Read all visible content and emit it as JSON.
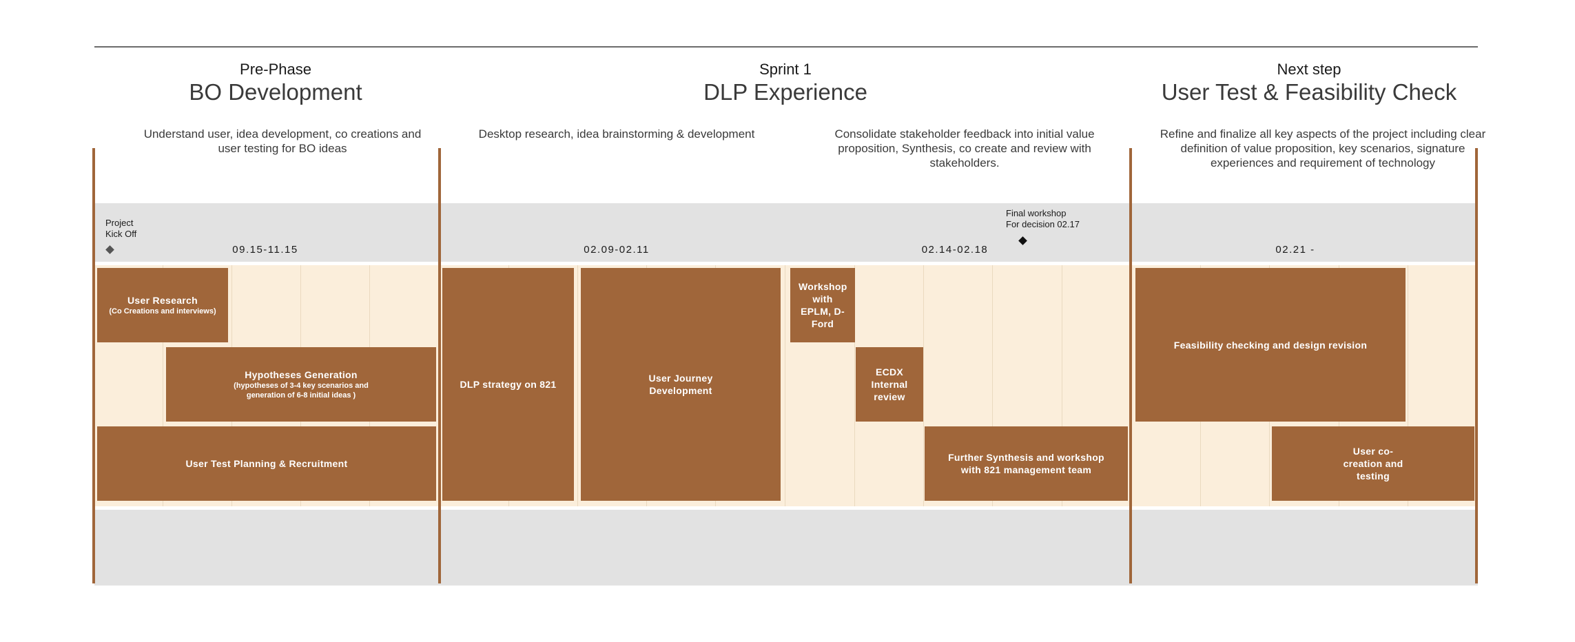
{
  "colors": {
    "task_fill": "#a0663a",
    "band_gray": "#e2e2e2",
    "band_cream": "#fbeedb",
    "divider": "#a0663a",
    "milestone": "#1a1a1a"
  },
  "phases": [
    {
      "subtitle": "Pre-Phase",
      "title": "BO Development",
      "descriptions": [
        "Understand user, idea development, co creations and user testing for BO ideas"
      ],
      "date": "09.15-11.15"
    },
    {
      "subtitle": "Sprint 1",
      "title": "DLP Experience",
      "descriptions": [
        "Desktop research, idea brainstorming & development",
        "Consolidate stakeholder feedback into initial value proposition, Synthesis, co create and review with stakeholders."
      ],
      "dates": [
        "02.09-02.11",
        "02.14-02.18"
      ]
    },
    {
      "subtitle": "Next step",
      "title": "User Test & Feasibility Check",
      "descriptions": [
        "Refine and finalize all key aspects of the project including clear definition of value proposition, key scenarios, signature experiences and requirement of technology"
      ],
      "date": "02.21 -"
    }
  ],
  "milestones": [
    {
      "label_lines": [
        "Project",
        "Kick Off"
      ],
      "icon": "diamond-icon"
    },
    {
      "label_lines": [
        "Final workshop",
        "For decision 02.17"
      ],
      "icon": "diamond-icon"
    }
  ],
  "tasks": [
    {
      "title": "User Research",
      "sub": "(Co Creations and interviews)"
    },
    {
      "title": "Hypotheses Generation",
      "sub": "(hypotheses of 3-4 key scenarios and generation of 6-8 initial ideas  )"
    },
    {
      "title": "User Test Planning & Recruitment"
    },
    {
      "title": "DLP strategy on 821"
    },
    {
      "title": "User Journey Development"
    },
    {
      "title": "Workshop with EPLM, D-Ford"
    },
    {
      "title": "ECDX Internal review"
    },
    {
      "title": "Further Synthesis and workshop with 821 management team"
    },
    {
      "title": "Feasibility checking and design revision"
    },
    {
      "title": "User co-creation and testing"
    }
  ]
}
